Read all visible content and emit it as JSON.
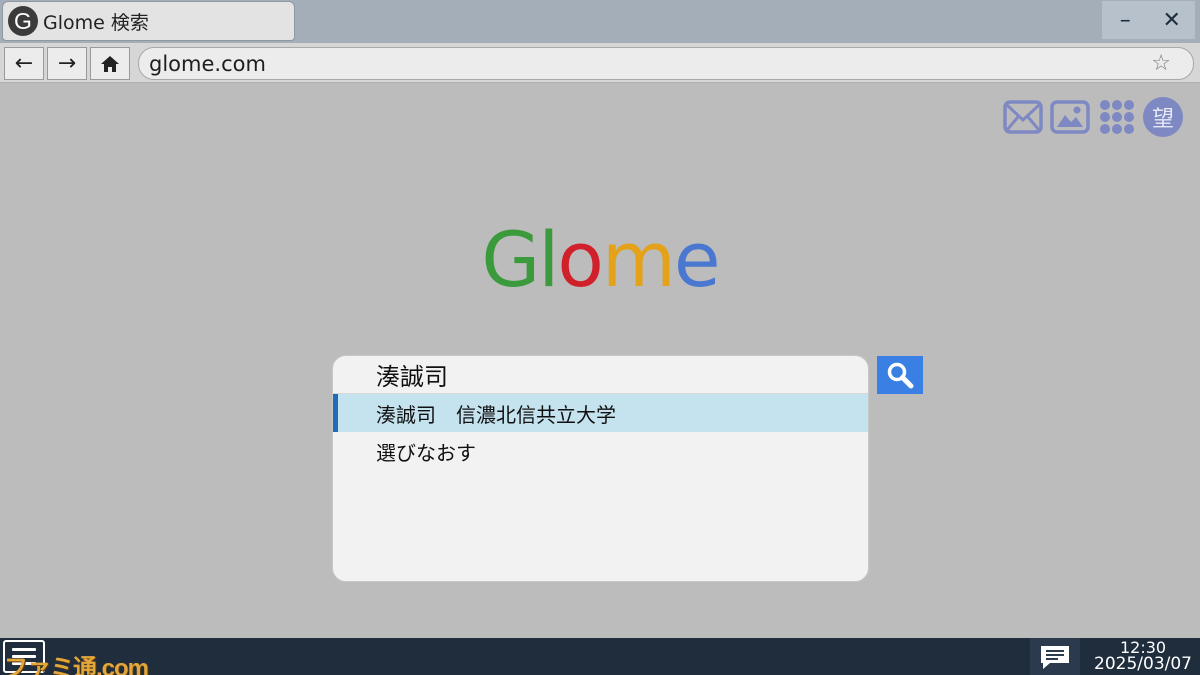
{
  "browser": {
    "tab_logo_letter": "G",
    "tab_title": "Glome 検索",
    "window_controls": {
      "minimize": "–",
      "close": "✕"
    },
    "nav": {
      "back": "←",
      "forward": "→",
      "home_icon": "home-icon"
    },
    "address": "glome.com",
    "bookmark_star": "☆"
  },
  "apps": {
    "icons": [
      "mail-icon",
      "image-icon",
      "apps-grid-icon"
    ],
    "avatar_char": "望",
    "accent_color": "#7e88c3"
  },
  "logo": {
    "letters": [
      {
        "char": "G",
        "color": "#3b9a3b"
      },
      {
        "char": "l",
        "color": "#3b9a3b"
      },
      {
        "char": "o",
        "color": "#d0202a"
      },
      {
        "char": "m",
        "color": "#e3a21a"
      },
      {
        "char": "e",
        "color": "#4a78d0"
      }
    ]
  },
  "search": {
    "query": "湊誠司",
    "suggestions": [
      {
        "label": "湊誠司　信濃北信共立大学",
        "selected": true
      },
      {
        "label": "選びなおす",
        "selected": false
      }
    ],
    "button_color": "#3a7fe4"
  },
  "taskbar": {
    "watermark": "ファミ通.com",
    "time": "12:30",
    "date": "2025/03/07"
  }
}
